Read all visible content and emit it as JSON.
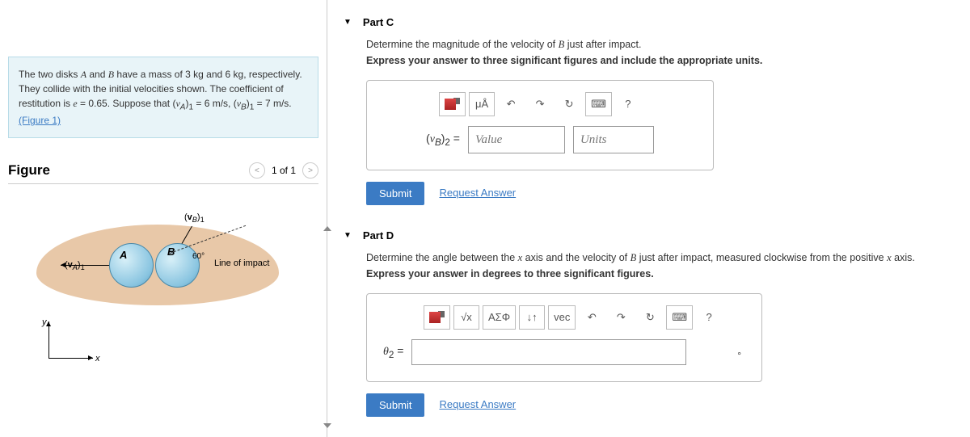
{
  "problem": {
    "text_prefix": "The two disks ",
    "A": "A",
    "and": " and ",
    "B": "B",
    "text_masses": " have a mass of 3 kg and 6 kg, respectively. They collide with the initial velocities shown. The coefficient of restitution is ",
    "e_eq": "e",
    "e_val": " = 0.65. Suppose that ",
    "va_sym": "(v_A)_1",
    "va_eq": " = 6 m/s, ",
    "vb_sym": "(v_B)_1",
    "vb_eq": " = 7 m/s. ",
    "fig_link": "(Figure 1)"
  },
  "figure": {
    "title": "Figure",
    "nav": "1 of 1",
    "labels": {
      "A": "A",
      "B": "B",
      "va": "(v_A)_1",
      "vb": "(v_B)_1",
      "angle": "60°",
      "line": "Line of impact",
      "x": "x",
      "y": "y"
    }
  },
  "partC": {
    "title": "Part C",
    "q1_pre": "Determine the magnitude of the velocity of ",
    "q1_b": "B",
    "q1_post": " just after impact.",
    "q2": "Express your answer to three significant figures and include the appropriate units.",
    "var": "(v_B)_2 =",
    "value_ph": "Value",
    "units_ph": "Units",
    "submit": "Submit",
    "request": "Request Answer",
    "help": "?",
    "ua": "μÅ"
  },
  "partD": {
    "title": "Part D",
    "q1_pre": "Determine the angle between the ",
    "q1_x1": "x",
    "q1_mid": " axis and the velocity of ",
    "q1_b": "B",
    "q1_post": " just after impact, measured clockwise from the positive ",
    "q1_x2": "x",
    "q1_end": " axis.",
    "q2": "Express your answer in degrees to three significant figures.",
    "var": "θ_2 =",
    "unit": "°",
    "submit": "Submit",
    "request": "Request Answer",
    "help": "?",
    "sigma": "ΑΣΦ",
    "arrows": "↓↑",
    "vec": "vec"
  }
}
